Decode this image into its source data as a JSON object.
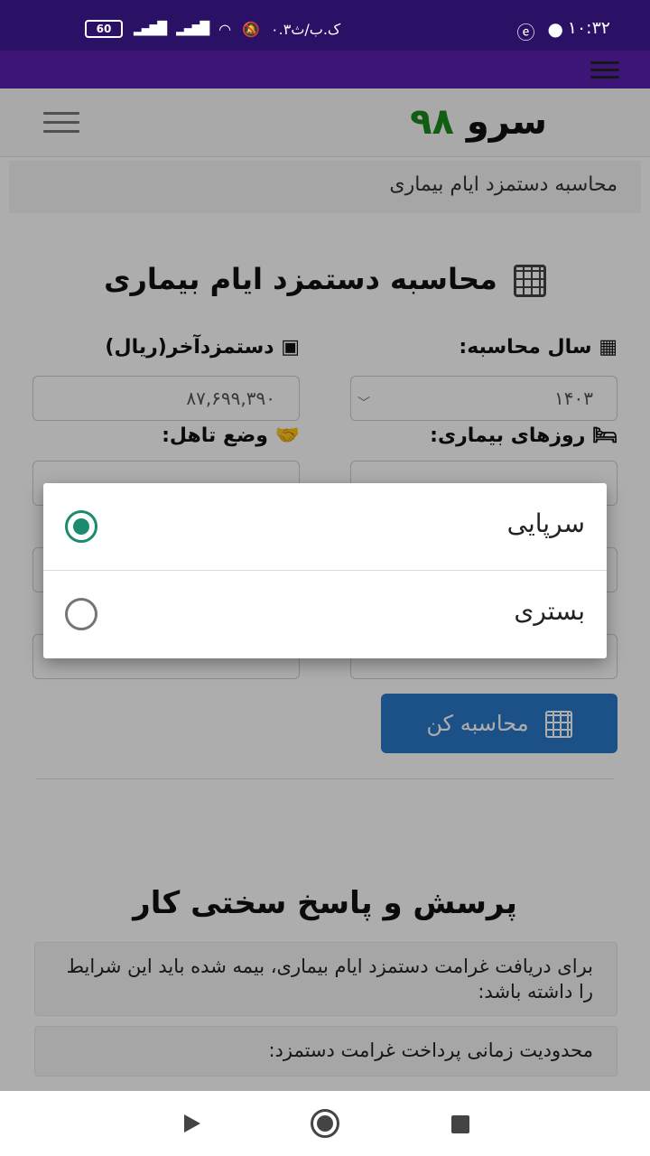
{
  "status_bar": {
    "time": "۱۰:۳۲",
    "date": "۰.۳ک.ب/ث",
    "battery": "60"
  },
  "header": {
    "logo_text": "سرو",
    "logo_number": "۹۸"
  },
  "breadcrumb": "محاسبه دستمزد ایام بیماری",
  "page_title": "محاسبه دستمزد ایام بیماری",
  "form": {
    "year_label": "سال محاسبه:",
    "year_value": "۱۴۰۳",
    "wage_label": "دستمزدآخر(ریال)",
    "wage_value": "۸۷,۶۹۹,۳۹۰",
    "sick_days_label": "روزهای بیماری:",
    "marital_label": "وضع تاهل:",
    "calculate_button": "محاسبه کن"
  },
  "faq": {
    "title": "پرسش و پاسخ سختی کار",
    "items": [
      "برای دریافت غرامت دستمزد ایام بیماری، بیمه شده باید این شرایط را داشته باشد:",
      "محدودیت زمانی پرداخت غرامت دستمزد:"
    ]
  },
  "dialog": {
    "options": [
      {
        "label": "سرپایی",
        "selected": true
      },
      {
        "label": "بستری",
        "selected": false
      }
    ]
  },
  "colors": {
    "status_bar": "#2b1166",
    "app_bar": "#5a1fae",
    "radio_accent": "#1b8a6f",
    "button": "#2a78c9",
    "logo_number": "#1a8a1a"
  }
}
